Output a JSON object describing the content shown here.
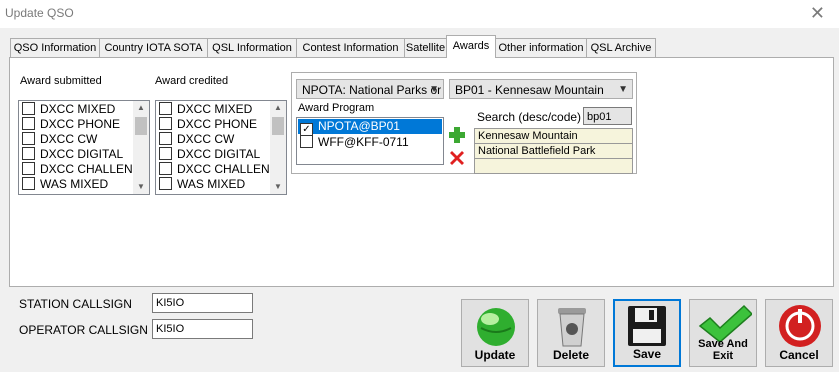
{
  "window": {
    "title": "Update QSO",
    "close_glyph": "✕"
  },
  "tabs": [
    "QSO Information",
    "Country IOTA SOTA",
    "QSL Information",
    "Contest Information",
    "Satellite",
    "Awards",
    "Other information",
    "QSL Archive"
  ],
  "awards": {
    "submitted_label": "Award submitted",
    "credited_label": "Award credited",
    "submitted_items": [
      "DXCC MIXED",
      "DXCC PHONE",
      "DXCC CW",
      "DXCC DIGITAL",
      "DXCC CHALLENGI",
      "WAS MIXED"
    ],
    "credited_items": [
      "DXCC MIXED",
      "DXCC PHONE",
      "DXCC CW",
      "DXCC DIGITAL",
      "DXCC CHALLENG",
      "WAS MIXED"
    ]
  },
  "program": {
    "program_combo": "NPOTA: National Parks or",
    "reference_combo": "BP01 - Kennesaw Mountain",
    "list_label": "Award Program",
    "items": [
      {
        "label": "NPOTA@BP01",
        "checked": true,
        "selected": true
      },
      {
        "label": "WFF@KFF-0711",
        "checked": false,
        "selected": false
      }
    ],
    "search_label": "Search (desc/code)",
    "search_value": "bp01",
    "details": [
      "Kennesaw Mountain",
      "National Battlefield Park",
      ""
    ],
    "add_icon": "plus-icon",
    "remove_icon": "x-icon"
  },
  "station": {
    "station_label": "STATION CALLSIGN",
    "station_value": "KI5IO",
    "operator_label": "OPERATOR CALLSIGN",
    "operator_value": "KI5IO"
  },
  "buttons": {
    "update": "Update",
    "delete": "Delete",
    "save": "Save",
    "save_exit_1": "Save And",
    "save_exit_2": "Exit",
    "cancel": "Cancel"
  }
}
